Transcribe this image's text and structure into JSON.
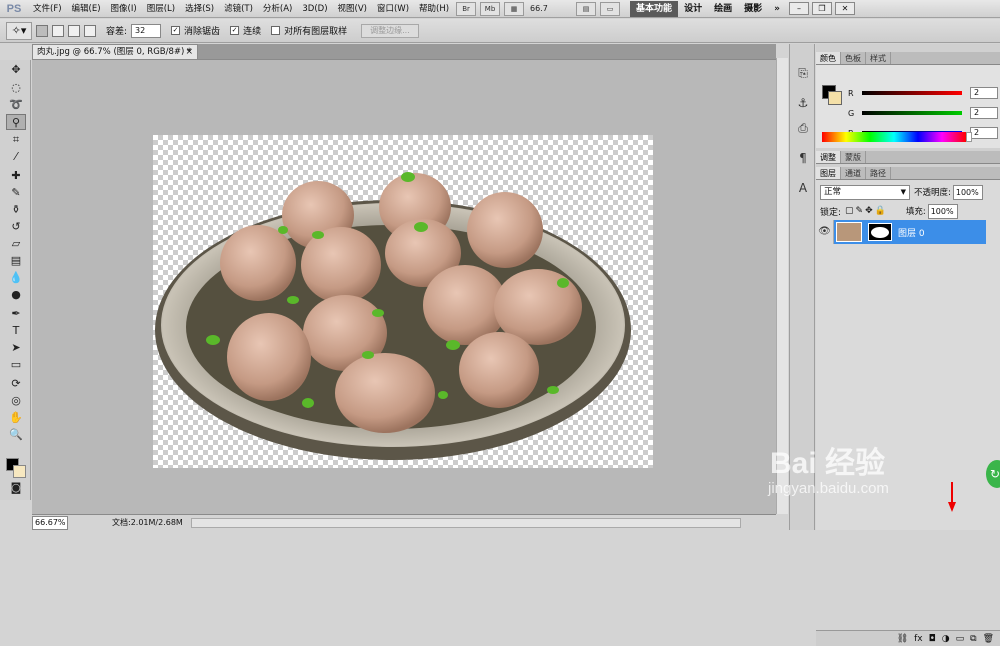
{
  "app": {
    "logo": "PS"
  },
  "menus": [
    "文件(F)",
    "编辑(E)",
    "图像(I)",
    "图层(L)",
    "选择(S)",
    "滤镜(T)",
    "分析(A)",
    "3D(D)",
    "视图(V)",
    "窗口(W)",
    "帮助(H)"
  ],
  "menubar": {
    "zoom": "66.7",
    "workspace_active": "基本功能",
    "workspaces": [
      "设计",
      "绘画",
      "摄影"
    ],
    "more": "»"
  },
  "options": {
    "tolerance_label": "容差:",
    "tolerance_value": "32",
    "antialias_label": "消除锯齿",
    "contiguous_label": "连续",
    "sample_all_label": "对所有图层取样",
    "refine_button": "调整边缘..."
  },
  "document": {
    "tab_title": "肉丸.jpg @ 66.7% (图层 0, RGB/8#) *",
    "close": "×"
  },
  "status": {
    "zoom": "66.67%",
    "doc_size": "文档:2.01M/2.68M"
  },
  "color_panel": {
    "tabs": [
      "颜色",
      "色板",
      "样式"
    ],
    "channels": [
      {
        "label": "R",
        "value": "2",
        "color": "#c00000"
      },
      {
        "label": "G",
        "value": "2",
        "color": "#00a000"
      },
      {
        "label": "B",
        "value": "2",
        "color": "#0000c0"
      }
    ]
  },
  "adjust_panel": {
    "tabs": [
      "调整",
      "蒙版"
    ]
  },
  "layers_panel": {
    "tabs": [
      "图层",
      "通道",
      "路径"
    ],
    "blend_mode": "正常",
    "opacity_label": "不透明度:",
    "opacity_value": "100%",
    "lock_label": "锁定:",
    "fill_label": "填充:",
    "fill_value": "100%",
    "layer_name": "图层 0"
  },
  "watermark": {
    "main": "Bai 经验",
    "sub": "jingyan.baidu.com"
  }
}
